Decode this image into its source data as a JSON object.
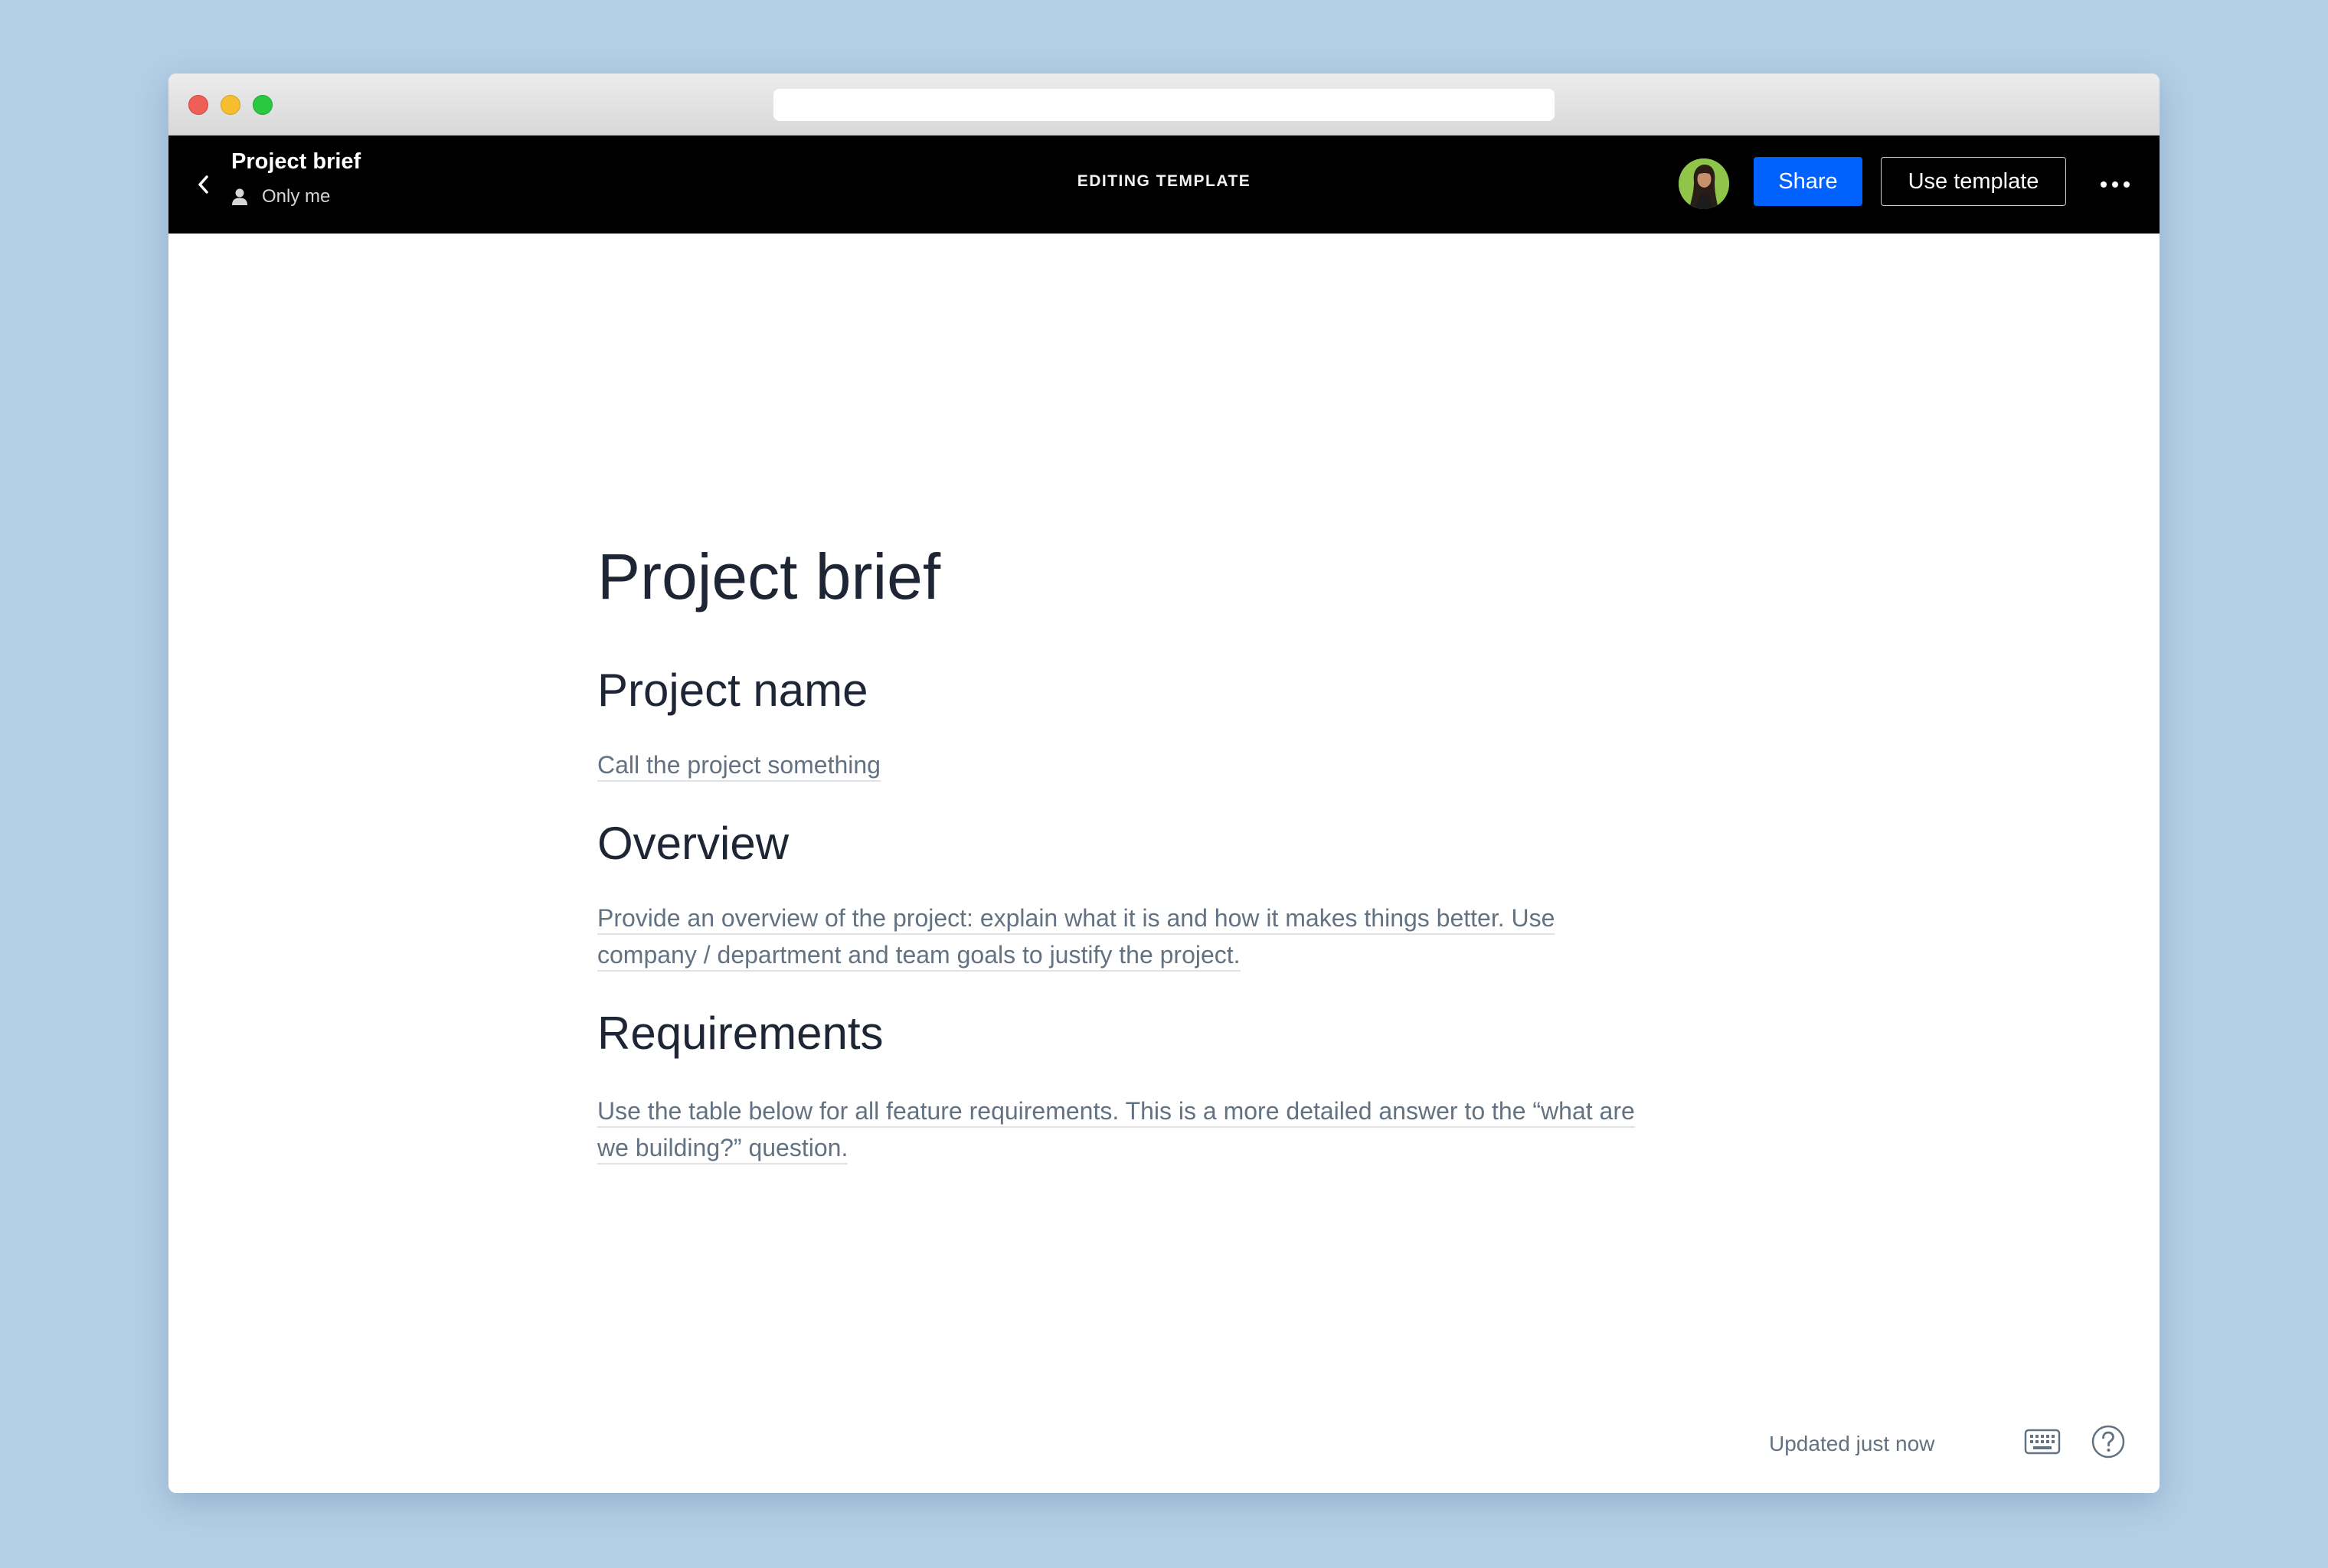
{
  "window": {
    "url": ""
  },
  "header": {
    "title": "Project brief",
    "sharing": "Only me",
    "mode": "EDITING TEMPLATE",
    "share_label": "Share",
    "use_template_label": "Use template"
  },
  "document": {
    "title": "Project brief",
    "sections": [
      {
        "heading": "Project name",
        "placeholder_lines": [
          "Call the project something"
        ]
      },
      {
        "heading": "Overview",
        "placeholder_lines": [
          "Provide an overview of the project: explain what it is and how it makes things better. Use",
          "company / department and team goals to justify the project."
        ]
      },
      {
        "heading": "Requirements",
        "placeholder_lines": [
          "Use the table below for all feature requirements. This is a more detailed answer to the “what are",
          "we building?” question."
        ]
      }
    ]
  },
  "footer": {
    "status": "Updated just now"
  },
  "colors": {
    "page_background": "#b3cfe6",
    "appbar": "#000000",
    "share_button": "#0061fe",
    "heading_text": "#1e2635",
    "placeholder_text": "#637282"
  },
  "icons": {
    "back": "chevron-left-icon",
    "sharing": "person-icon",
    "more": "more-horizontal-icon",
    "keyboard": "keyboard-icon",
    "help": "help-circle-icon"
  }
}
